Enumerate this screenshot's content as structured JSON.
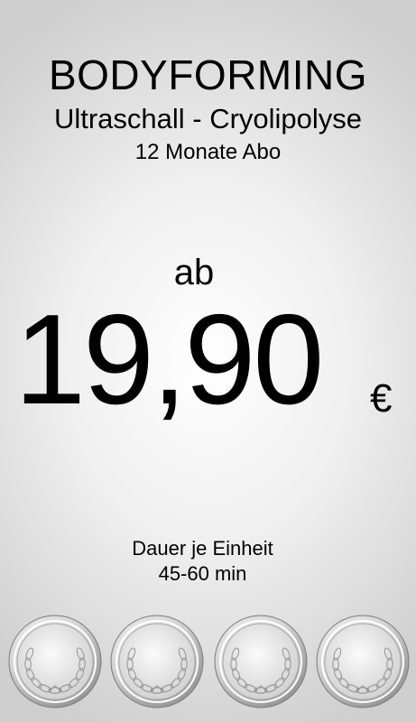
{
  "offer": {
    "title": "BODYFORMING",
    "subtitle": "Ultraschall - Cryolipolyse",
    "subscription": "12 Monate Abo"
  },
  "price": {
    "prefix": "ab",
    "amount": "19,90",
    "currency": "€"
  },
  "duration": {
    "label": "Dauer je Einheit",
    "value": "45-60 min"
  },
  "medals": {
    "icon": "laurel-wreath-icon",
    "count": 4,
    "color": "#c8c8c8"
  }
}
